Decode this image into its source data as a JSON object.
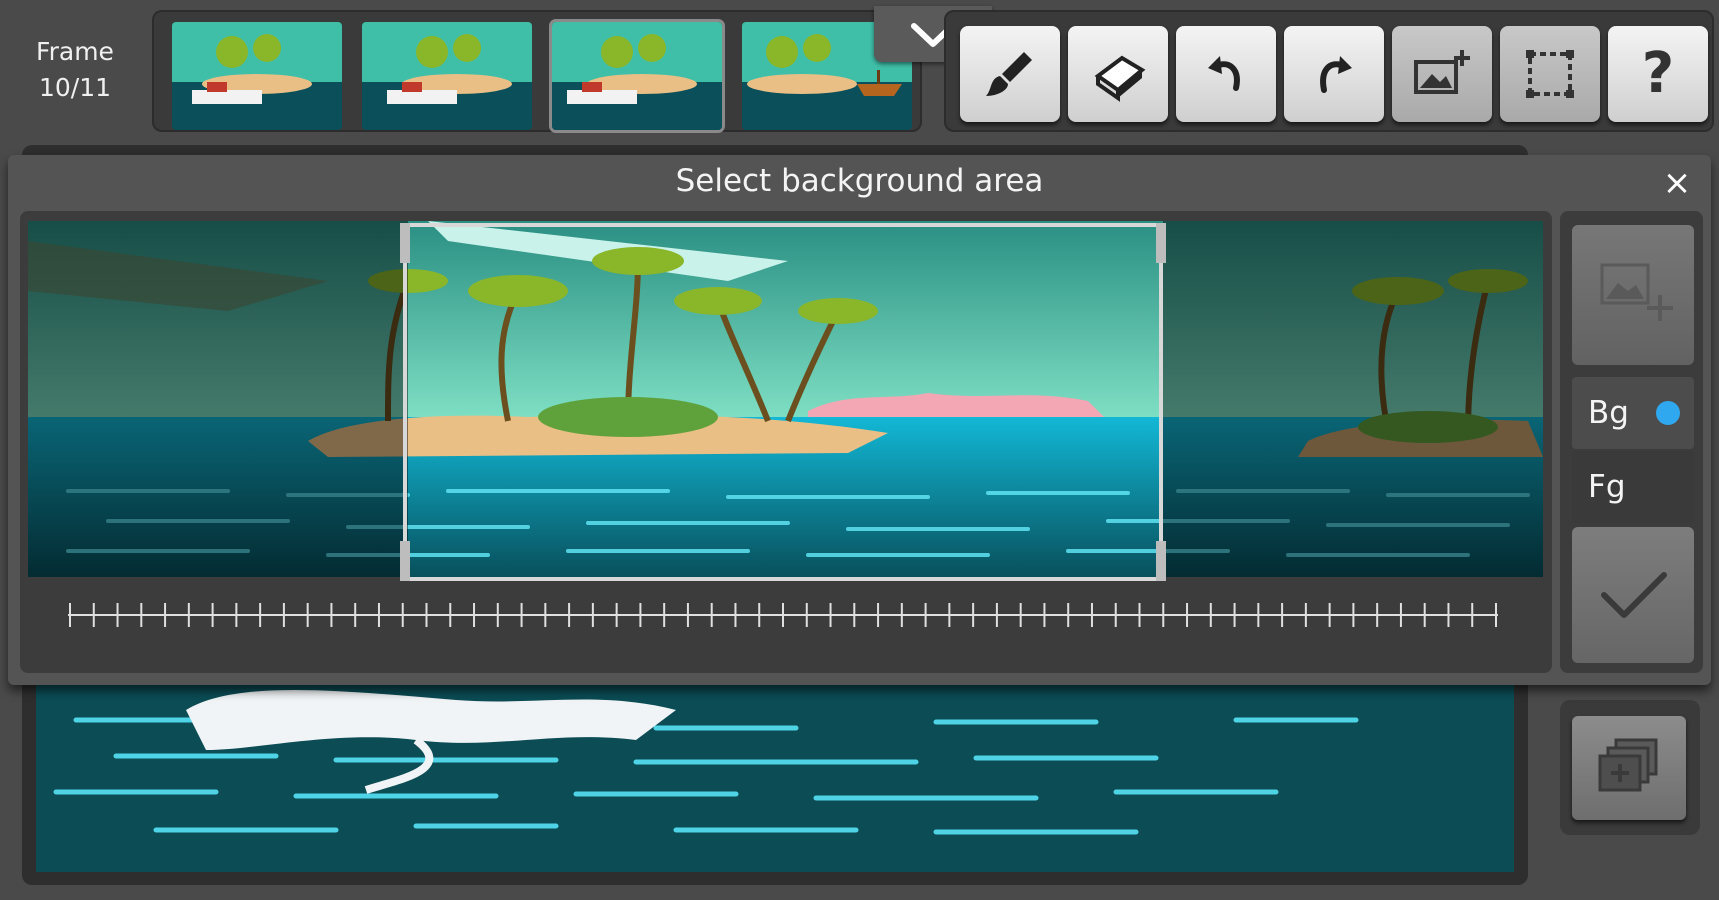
{
  "header": {
    "frame_label": "Frame",
    "frame_count": "10/11"
  },
  "thumbnails": [
    {
      "name": "frame-7"
    },
    {
      "name": "frame-8"
    },
    {
      "name": "frame-9",
      "selected": true
    },
    {
      "name": "frame-10"
    }
  ],
  "toolbar": {
    "tools": [
      {
        "name": "brush-icon"
      },
      {
        "name": "eraser-icon"
      },
      {
        "name": "undo-icon"
      },
      {
        "name": "redo-icon"
      },
      {
        "name": "add-image-icon"
      },
      {
        "name": "selection-icon"
      },
      {
        "name": "help-icon",
        "label": "?"
      }
    ]
  },
  "dialog": {
    "title": "Select background area",
    "close_symbol": "×"
  },
  "layers": {
    "bg_label": "Bg",
    "fg_label": "Fg",
    "active": "Bg",
    "accent": "#2fa8f0"
  },
  "colors": {
    "sky": "#3fbfa8",
    "sea": "#0a4f5a",
    "sand": "#e9bf86",
    "palm": "#8ab62a"
  }
}
